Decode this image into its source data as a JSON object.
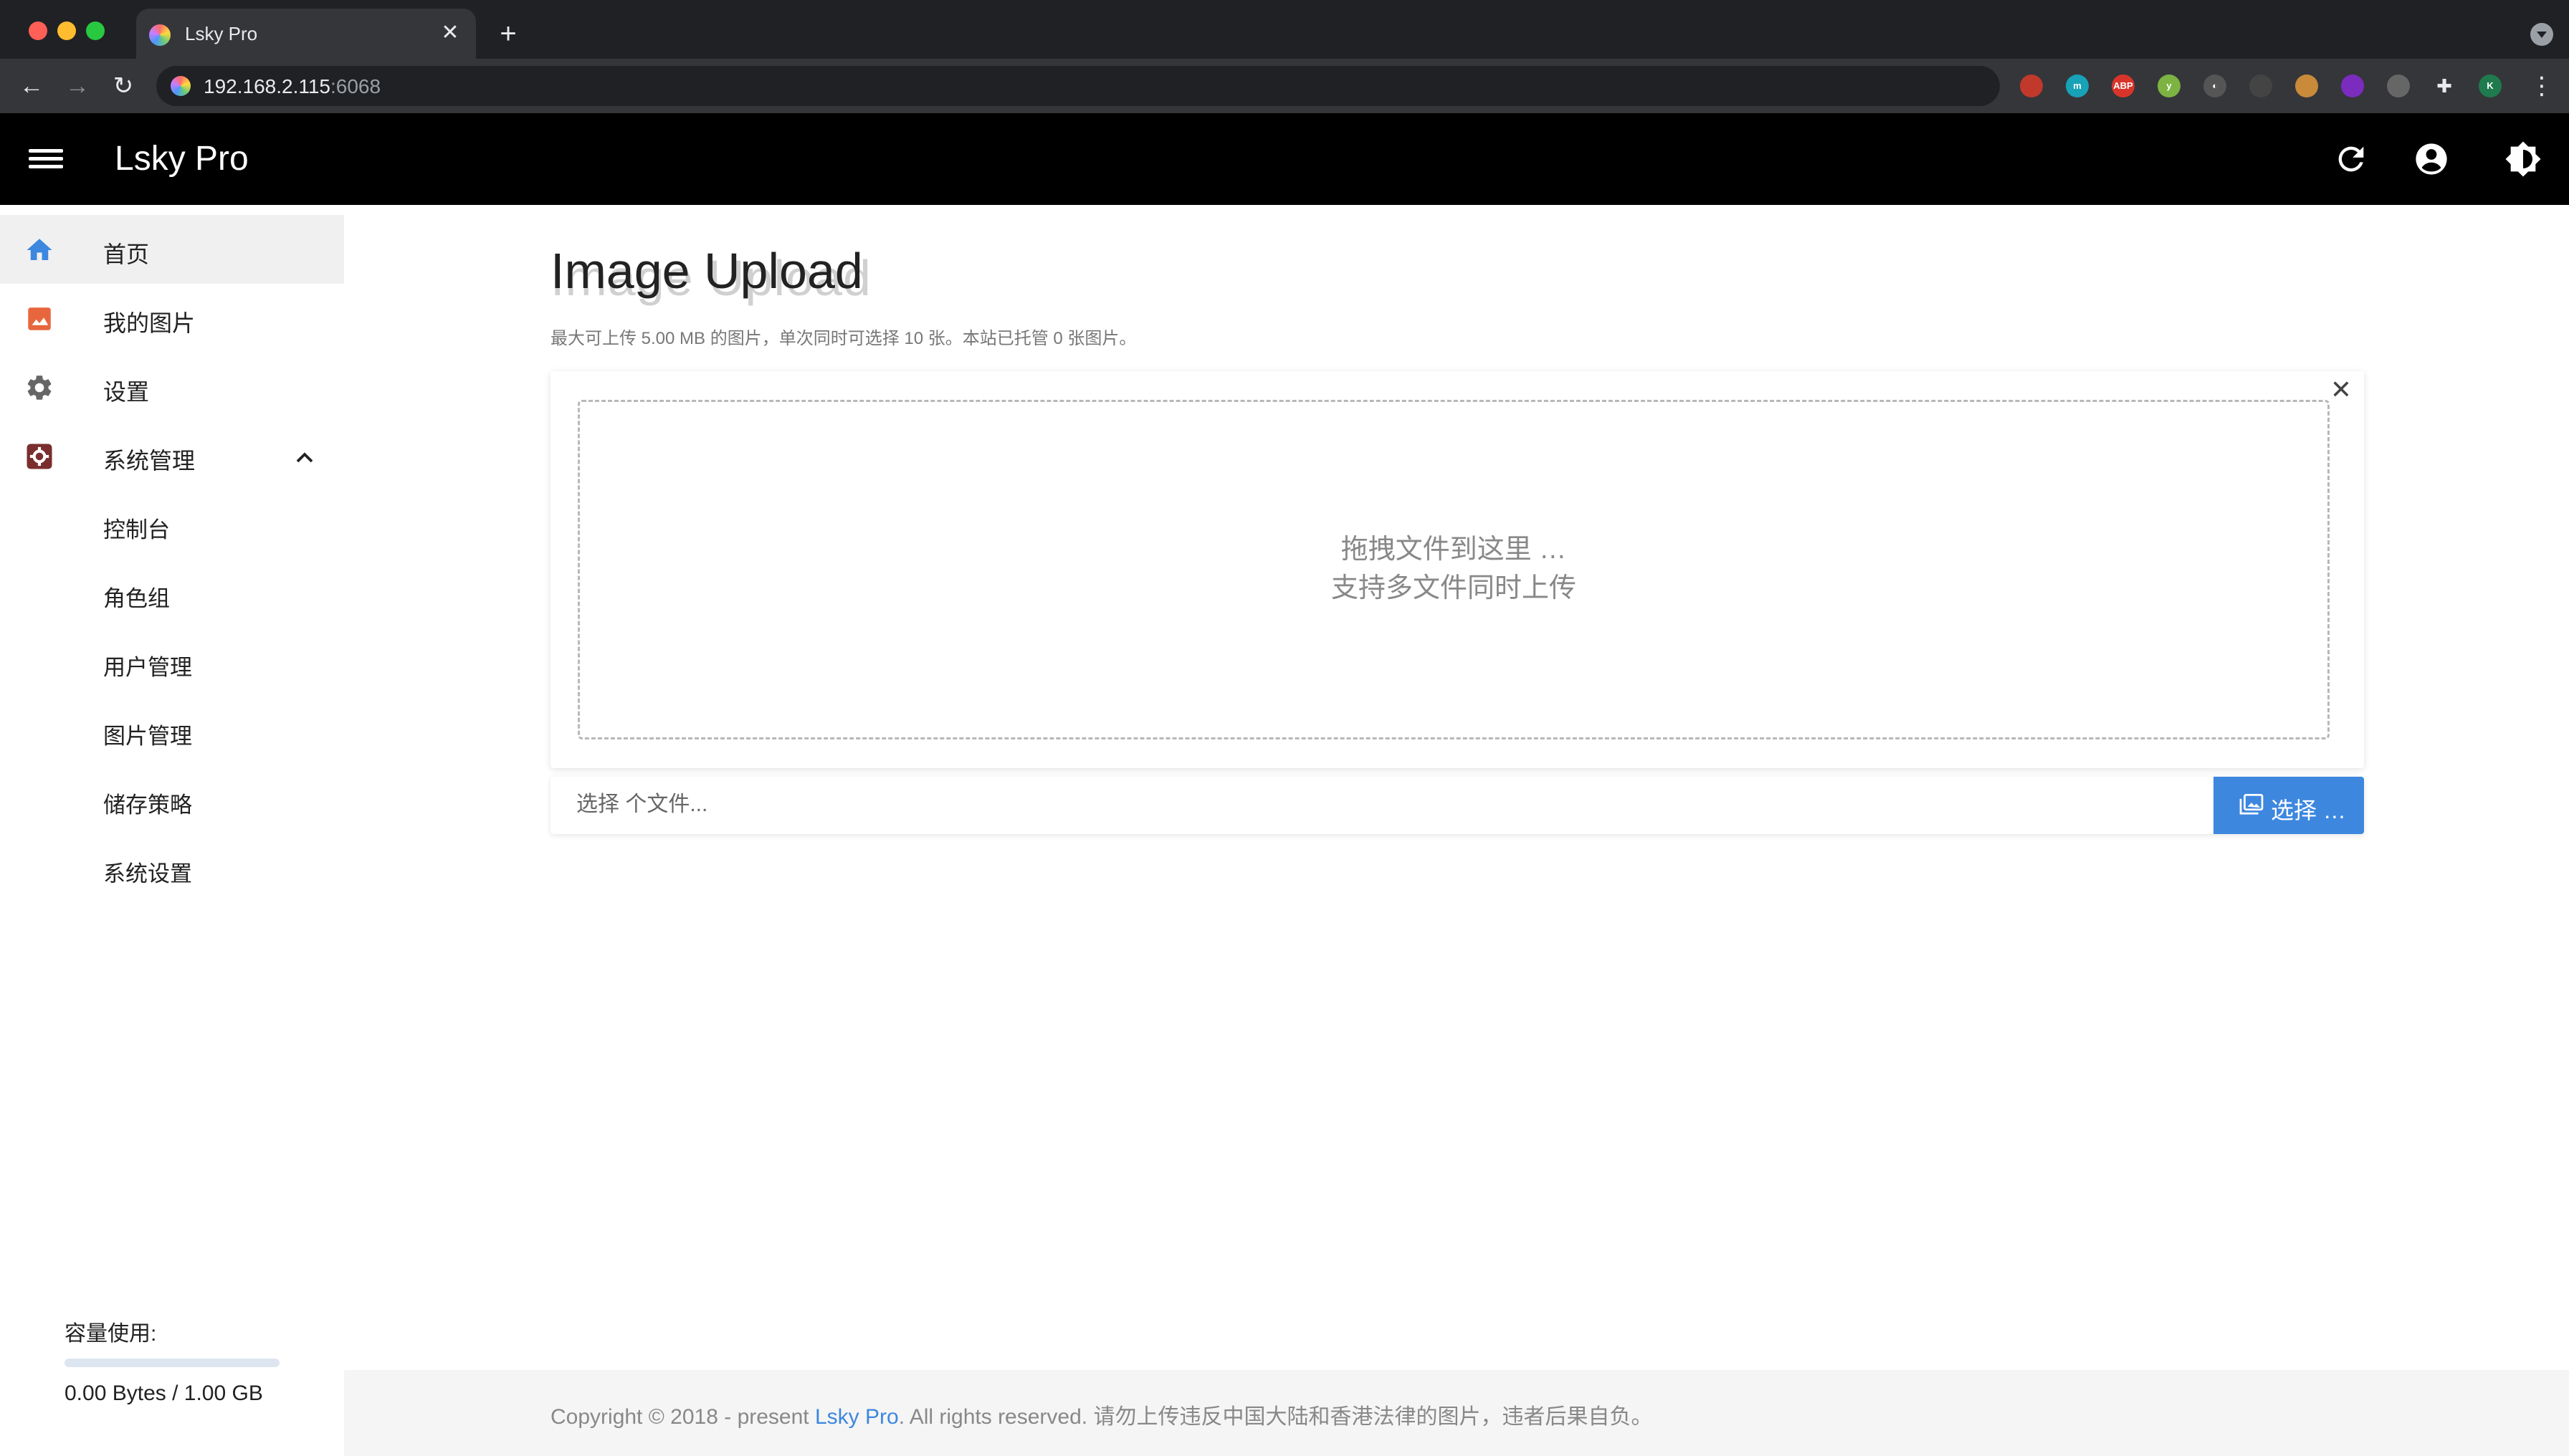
{
  "browser": {
    "tab_title": "Lsky Pro",
    "url_host": "192.168.2.115",
    "url_port": ":6068",
    "extensions": [
      {
        "name": "ext-red-icon",
        "text": "",
        "color": "#c0392b"
      },
      {
        "name": "ext-m-icon",
        "text": "m",
        "color": "#17a2b8"
      },
      {
        "name": "ext-abp-icon",
        "text": "ABP",
        "color": "#d9342b"
      },
      {
        "name": "ext-y-icon",
        "text": "y",
        "color": "#7cb342"
      },
      {
        "name": "ext-circle-icon",
        "text": "◐",
        "color": "#555"
      },
      {
        "name": "ext-shield-icon",
        "text": "",
        "color": "#444"
      },
      {
        "name": "ext-cookie-icon",
        "text": "",
        "color": "#c98a3a"
      },
      {
        "name": "ext-purple-icon",
        "text": "",
        "color": "#7b2cbf"
      },
      {
        "name": "ext-gray-icon",
        "text": "",
        "color": "#666"
      },
      {
        "name": "puzzle-icon",
        "text": "",
        "color": "#35363a"
      },
      {
        "name": "profile-avatar-icon",
        "text": "K",
        "color": "#1f7a4d"
      }
    ]
  },
  "header": {
    "title": "Lsky Pro"
  },
  "sidebar": {
    "items": [
      {
        "label": "首页",
        "icon": "home-icon"
      },
      {
        "label": "我的图片",
        "icon": "image-icon"
      },
      {
        "label": "设置",
        "icon": "gear-icon"
      },
      {
        "label": "系统管理",
        "icon": "admin-icon"
      }
    ],
    "sub_items": [
      {
        "label": "控制台"
      },
      {
        "label": "角色组"
      },
      {
        "label": "用户管理"
      },
      {
        "label": "图片管理"
      },
      {
        "label": "储存策略"
      },
      {
        "label": "系统设置"
      }
    ],
    "storage_label": "容量使用:",
    "storage_text": "0.00 Bytes / 1.00 GB",
    "storage_used_fraction": 0
  },
  "main": {
    "title": "Image Upload",
    "subtitle": "最大可上传 5.00 MB 的图片，单次同时可选择 10 张。本站已托管 0 张图片。",
    "dropzone_line1": "拖拽文件到这里 …",
    "dropzone_line2": "支持多文件同时上传",
    "file_placeholder": "选择 个文件...",
    "browse_label": "选择 …"
  },
  "footer": {
    "prefix": "Copyright © 2018 - present ",
    "link": "Lsky Pro",
    "suffix": ". All rights reserved. 请勿上传违反中国大陆和香港法律的图片，违者后果自负。"
  },
  "colors": {
    "accent": "#3d87df",
    "home_icon": "#3d87df",
    "image_icon": "#e8663d",
    "header_bg": "#000000"
  }
}
